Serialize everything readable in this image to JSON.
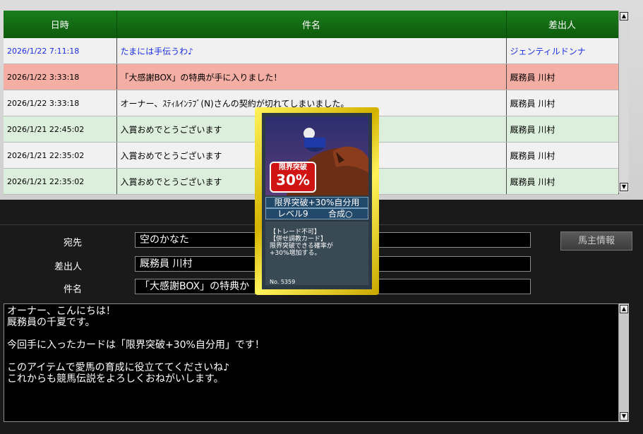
{
  "mail_list": {
    "columns": [
      "日時",
      "件名",
      "差出人"
    ],
    "rows": [
      {
        "date": "2026/1/22 7:11:18",
        "subject": "たまには手伝うわ♪",
        "sender": "ジェンティルドンナ",
        "state": "unread"
      },
      {
        "date": "2026/1/22 3:33:18",
        "subject": "「大感謝BOX」の特典が手に入りました！",
        "sender": "厩務員 川村",
        "state": "selected"
      },
      {
        "date": "2026/1/22 3:33:18",
        "subject": "オーナー、ｽﾃｨﾙｲﾝﾗﾌﾞ(N)さんの契約が切れてしまいました。",
        "sender": "厩務員 川村",
        "state": "normal"
      },
      {
        "date": "2026/1/21 22:45:02",
        "subject": "入賞おめでとうございます",
        "sender": "厩務員 川村",
        "state": "read"
      },
      {
        "date": "2026/1/21 22:35:02",
        "subject": "入賞おめでとうございます",
        "sender": "厩務員 川村",
        "state": "normal"
      },
      {
        "date": "2026/1/21 22:35:02",
        "subject": "入賞おめでとうございます",
        "sender": "厩務員 川村",
        "state": "read"
      }
    ]
  },
  "form": {
    "to_label": "宛先",
    "to_value": "空のかなた",
    "from_label": "差出人",
    "from_value": "厩務員 川村",
    "subject_label": "件名",
    "subject_value": "「大感謝BOX」の特典か",
    "owner_button": "馬主情報"
  },
  "message_body": [
    "オーナー、こんにちは！",
    "厩務員の千夏です。",
    "",
    "今回手に入ったカードは「限界突破+30%自分用」です！",
    "",
    "このアイテムで愛馬の育成に役立ててくださいね♪",
    "これからも競馬伝説をよろしくおねがいします。"
  ],
  "card": {
    "badge_top": "限界突破",
    "badge_value": "30%",
    "name": "限界突破+30%自分用",
    "level": "レベル9",
    "combine": "合成○",
    "desc": [
      "【トレード不可】",
      "【併せ調教カード】",
      "限界突破できる確率が",
      "+30%増加する。"
    ],
    "number": "No. 5359"
  },
  "scroll_icons": {
    "up": "▲",
    "down": "▼"
  },
  "colors": {
    "header_green": "#0f6a0f",
    "selected_row": "#f4aea4",
    "read_row": "#dcefdc",
    "unread_text": "#1b2ee8",
    "card_gold": "#e8d000"
  }
}
